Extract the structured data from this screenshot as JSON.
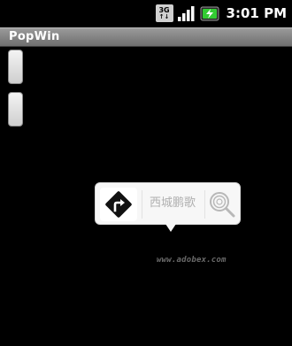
{
  "status_bar": {
    "network_type": "3G",
    "time": "3:01 PM"
  },
  "app": {
    "title": "PopWin"
  },
  "buttons": [
    {
      "label": ""
    },
    {
      "label": ""
    }
  ],
  "popup": {
    "place_name": "西城鹏歌",
    "navigate_icon": "turn-right-icon",
    "search_icon": "search-icon"
  },
  "watermark": "www.adobex.com",
  "colors": {
    "background": "#000000",
    "title_bar": "#8a8a8a",
    "popup_bg": "#f7f7f7",
    "battery_accent": "#33cc33"
  }
}
